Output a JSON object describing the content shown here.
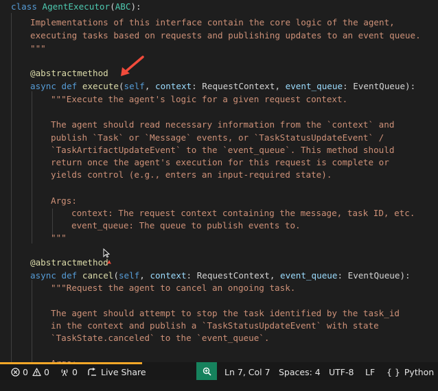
{
  "code": {
    "line1": {
      "kw": "class",
      "name": "AgentExecutor",
      "open": "(",
      "base": "ABC",
      "close": "):"
    },
    "line2": "Implementations of this interface contain the core logic of the agent,",
    "line3": "executing tasks based on requests and publishing updates to an event queue.",
    "line4": "\"\"\"",
    "line5": "@abstractmethod",
    "line6": {
      "kw1": "async",
      "kw2": "def",
      "fn": "execute",
      "p1": "(",
      "self": "self",
      "c1": ", ",
      "arg1": "context",
      "col1": ": ",
      "type1": "RequestContext",
      "c2": ", ",
      "arg2": "event_queue",
      "col2": ": ",
      "type2": "EventQueue",
      "end": "):"
    },
    "line7": "\"\"\"Execute the agent's logic for a given request context.",
    "line8": "The agent should read necessary information from the `context` and",
    "line9": "publish `Task` or `Message` events, or `TaskStatusUpdateEvent` /",
    "line10": "`TaskArtifactUpdateEvent` to the `event_queue`. This method should",
    "line11": "return once the agent's execution for this request is complete or",
    "line12": "yields control (e.g., enters an input-required state).",
    "line13": "Args:",
    "line14": "context: The request context containing the message, task ID, etc.",
    "line15": "event_queue: The queue to publish events to.",
    "line16": "\"\"\"",
    "line17": "@abstractmethod",
    "line18": {
      "kw1": "async",
      "kw2": "def",
      "fn": "cancel",
      "p1": "(",
      "self": "self",
      "c1": ", ",
      "arg1": "context",
      "col1": ": ",
      "type1": "RequestContext",
      "c2": ", ",
      "arg2": "event_queue",
      "col2": ": ",
      "type2": "EventQueue",
      "end": "):"
    },
    "line19": "\"\"\"Request the agent to cancel an ongoing task.",
    "line20": "The agent should attempt to stop the task identified by the task_id",
    "line21": "in the context and publish a `TaskStatusUpdateEvent` with state",
    "line22": "`TaskState.canceled` to the `event_queue`.",
    "line23": "Args:"
  },
  "status": {
    "errors": "0",
    "warnings": "0",
    "ports": "0",
    "live_share": "Live Share",
    "position": "Ln 7, Col 7",
    "spaces": "Spaces: 4",
    "encoding": "UTF-8",
    "eol": "LF",
    "language": "Python",
    "language_icon": "{ }"
  },
  "colors": {
    "background": "#1e1e1e",
    "keyword": "#569cd6",
    "function": "#dcdcaa",
    "class": "#4ec9b0",
    "parameter": "#9cdcfe",
    "string": "#ce9178",
    "arrow": "#f24b3b",
    "statusbar_accent": "#16825d",
    "progress": "#f7a828"
  },
  "icons": {
    "annotation": "red-arrow-icon",
    "pointer": "mouse-cursor-icon",
    "errors": "error-circle-icon",
    "warnings": "warning-triangle-icon",
    "ports": "broadcast-icon",
    "live_share": "live-share-icon",
    "zoom": "zoom-icon",
    "language": "braces-icon"
  }
}
